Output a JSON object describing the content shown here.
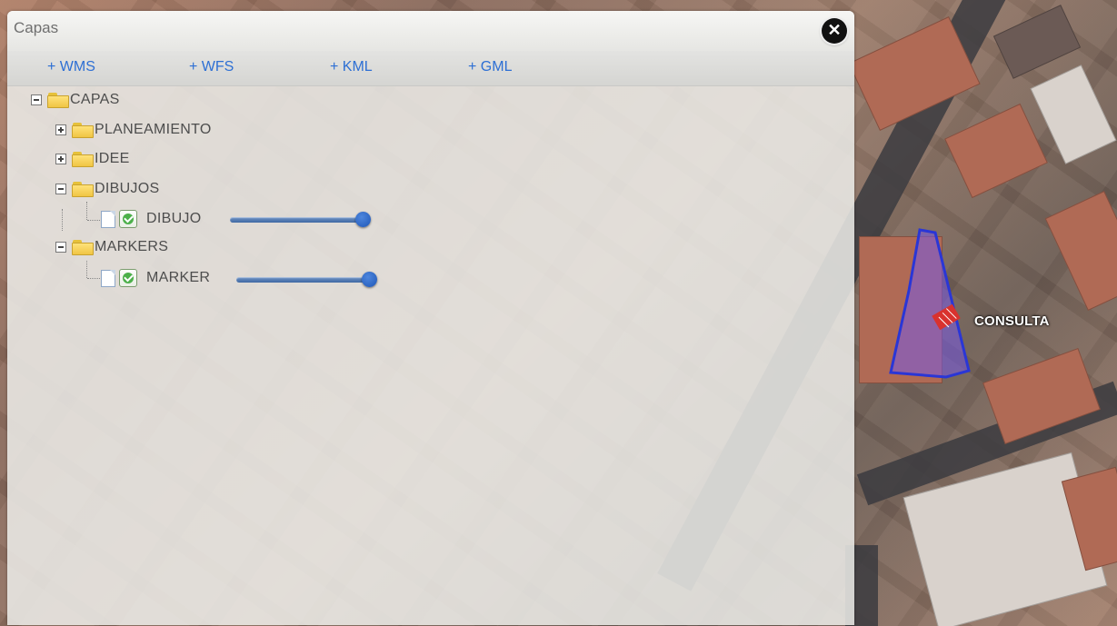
{
  "panel": {
    "title": "Capas",
    "close_icon": "close-icon"
  },
  "toolbar": {
    "wms": "+ WMS",
    "wfs": "+ WFS",
    "kml": "+ KML",
    "gml": "+ GML",
    "link_color": "#2d6fd4"
  },
  "tree": {
    "root": {
      "label": "CAPAS",
      "state": "expanded"
    },
    "folders": [
      {
        "label": "PLANEAMIENTO",
        "state": "collapsed"
      },
      {
        "label": "IDEE",
        "state": "collapsed"
      },
      {
        "label": "DIBUJOS",
        "state": "expanded"
      },
      {
        "label": "MARKERS",
        "state": "expanded"
      }
    ],
    "layers": [
      {
        "label": "DIBUJO",
        "checked": true,
        "opacity": 1.0
      },
      {
        "label": "MARKER",
        "checked": true,
        "opacity": 1.0
      }
    ]
  },
  "map": {
    "consulta_label": "CONSULTA",
    "polygon_color": "#2a36d6"
  }
}
